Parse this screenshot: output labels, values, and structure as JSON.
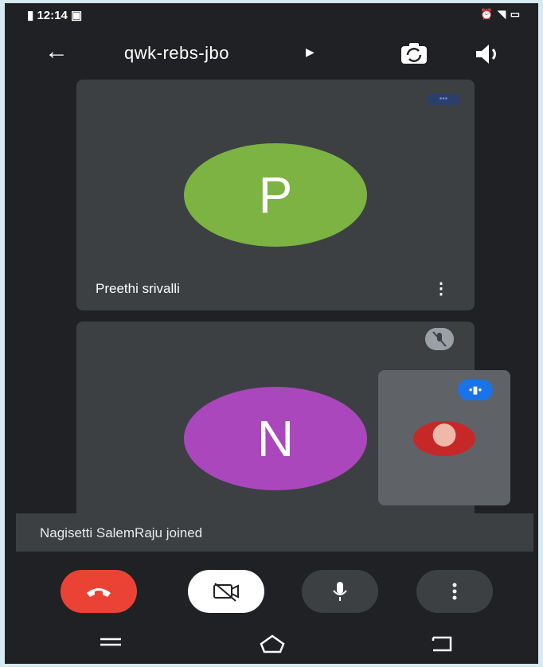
{
  "status_bar": {
    "time": "12:14",
    "left_icons": [
      "signal-icon",
      "message-icon"
    ],
    "right_icons": [
      "alarm-icon",
      "signal-icon",
      "wifi-icon",
      "battery-icon"
    ]
  },
  "app_bar": {
    "meeting_code": "qwk-rebs-jbo",
    "icons": [
      "back-arrow-icon",
      "caret-right-icon",
      "switch-camera-icon",
      "speaker-icon"
    ]
  },
  "participants": [
    {
      "initial": "P",
      "name": "Preethi srivalli",
      "avatar_color": "#7cb342",
      "status": "speaking"
    },
    {
      "initial": "N",
      "name": "",
      "avatar_color": "#ab47bc",
      "status": "muted"
    }
  ],
  "self_view": {
    "status": "speaking"
  },
  "toast": {
    "message": "Nagisetti SalemRaju joined"
  },
  "controls": {
    "buttons": [
      "end-call",
      "camera-off",
      "microphone",
      "more-options"
    ],
    "colors": {
      "end_call": "#ea4335",
      "camera": "#ffffff",
      "default": "#3c4043"
    }
  },
  "nav_bar": {
    "buttons": [
      "menu",
      "home",
      "back"
    ]
  }
}
